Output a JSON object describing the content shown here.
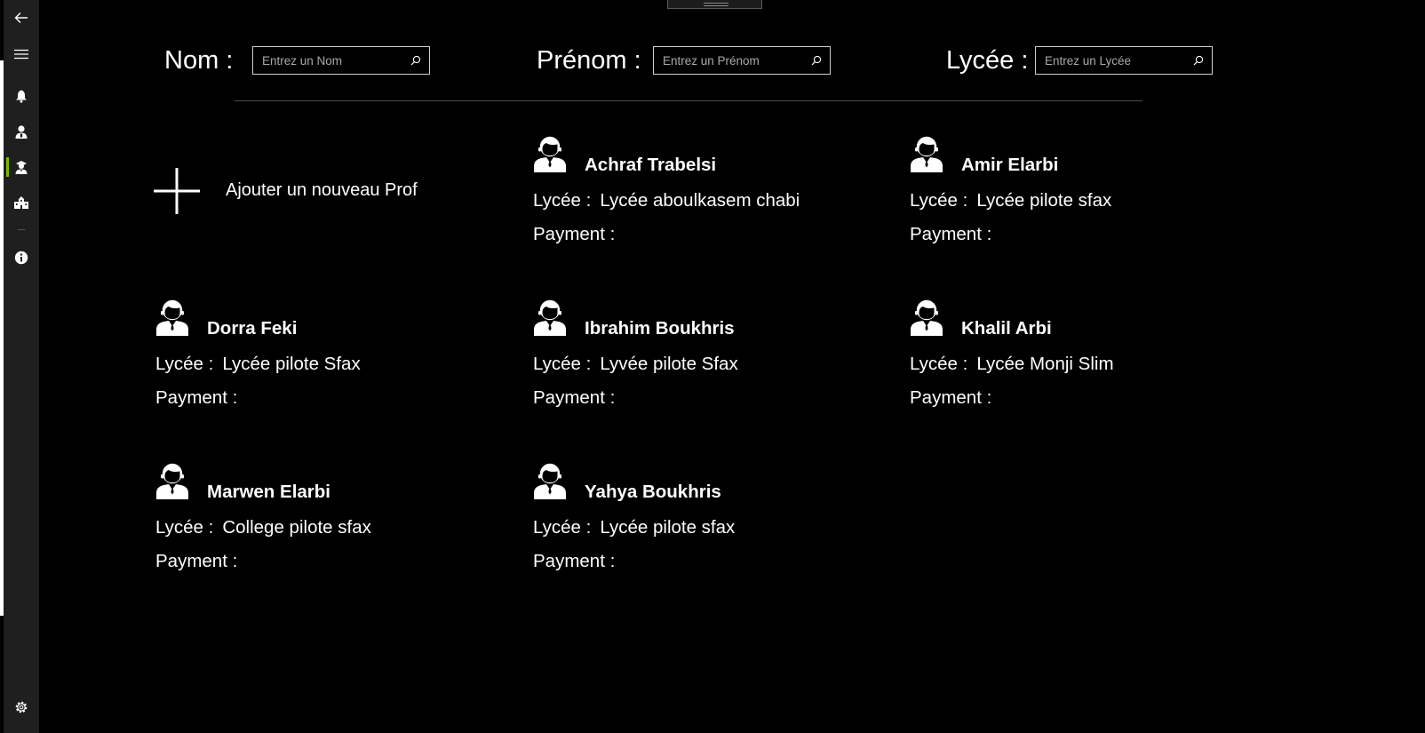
{
  "nav": {
    "items": [
      {
        "name": "back-arrow-icon"
      },
      {
        "name": "hamburger-menu-icon"
      },
      {
        "name": "bell-icon"
      },
      {
        "name": "student-icon"
      },
      {
        "name": "teacher-icon"
      },
      {
        "name": "school-building-icon"
      },
      {
        "name": "info-icon"
      },
      {
        "name": "settings-gear-icon"
      }
    ],
    "selected": "teacher-icon",
    "accent_color": "#7fba00"
  },
  "filters": {
    "nom": {
      "label": "Nom :",
      "placeholder": "Entrez un Nom",
      "value": ""
    },
    "prenom": {
      "label": "Prénom :",
      "placeholder": "Entrez un Prénom",
      "value": ""
    },
    "lycee": {
      "label": "Lycée :",
      "placeholder": "Entrez un Lycée",
      "value": ""
    }
  },
  "add_new": {
    "label": "Ajouter un nouveau Prof",
    "icon": "plus-icon"
  },
  "field_labels": {
    "lycee": "Lycée :",
    "payment": "Payment :"
  },
  "profs": [
    {
      "name": "Achraf Trabelsi",
      "lycee": "Lycée aboulkasem chabi",
      "payment": ""
    },
    {
      "name": "Amir Elarbi",
      "lycee": "Lycée pilote sfax",
      "payment": ""
    },
    {
      "name": "Dorra Feki",
      "lycee": "Lycée pilote Sfax",
      "payment": ""
    },
    {
      "name": "Ibrahim Boukhris",
      "lycee": "Lyvée pilote Sfax",
      "payment": ""
    },
    {
      "name": "Khalil Arbi",
      "lycee": "Lycée Monji Slim",
      "payment": ""
    },
    {
      "name": "Marwen Elarbi",
      "lycee": "College pilote sfax",
      "payment": ""
    },
    {
      "name": "Yahya Boukhris",
      "lycee": "Lycée pilote sfax",
      "payment": ""
    }
  ]
}
